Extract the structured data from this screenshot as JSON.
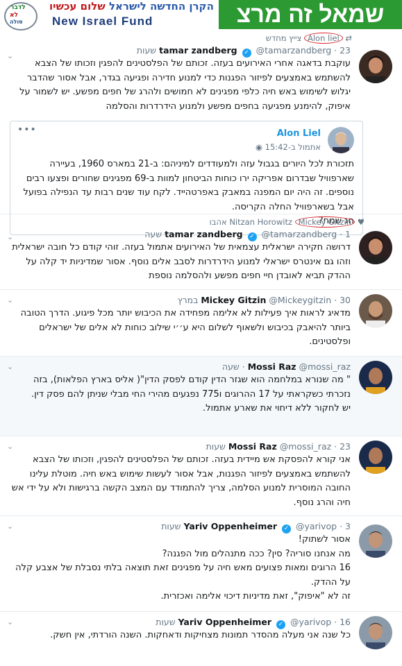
{
  "banner": {
    "logo_line1": "לדבר",
    "logo_line2": "לא",
    "logo_line3": "סולה",
    "nif_hebrew_main": "הקרן החדשה לישראל",
    "nif_hebrew_accent": "שלום עכשיו",
    "nif_english": "New Israel Fund",
    "campaign_text": "שמאל זה מרצ"
  },
  "tweets": [
    {
      "context_name": "Alon liel",
      "context_suffix": "צייץ מחדש",
      "name": "tamar zandberg",
      "handle": "@tamarzandberg",
      "time": "23 שעות",
      "body": "עוקבת בדאגה אחרי האירועים בעזה. זכותם של הפלסטינים להפגין וזכותו של הצבא להשתמש באמצעים לפיזור הפגנות כדי למנוע חדירה ופגיעה בגדר, אבל אסור שהדבר יגלוש לשימוש באש חיה כלפי מפגינים לא חמושים ולהרג של חפים מפשע. יש לשמור על איפוק, להימנע מפגיעה בחפים מפשע ולמנוע הידרדרות והסלמה",
      "quote": {
        "name": "Alon Liel",
        "time": "אתמול ב-15:42",
        "body": "תזכורת לכל היורים בגבול עזה ולמעודדים למיניהם: ב-21 במארס 1960, בעיירה שארפוויל שבדרום אפריקה ירו כוחות הביטחון למוות ב-69 מפגינים שחורים ופצעו רבים נוספים. זה היה יום המפנה במאבק באפרטהייד. לקח עוד שנים רבות עד הנפילה בפועל אבל בשארפוויל החלה הקריסה.",
        "tail": "חג שמח?"
      }
    },
    {
      "context_names": "Nitzan Horowitz",
      "context_circled": "Mickey Gitzin",
      "context_suffix": "אהבו",
      "name": "tamar zandberg",
      "handle": "@tamarzandberg",
      "time": "1 שעה",
      "body": "דרושה חקירה ישראלית עצמאית של האירועים אתמול בעזה. זוהי קודם כל חובה ישראלית וזהו גם אינטרס ישראלי למנוע הידרדרות לסבב אלים נוסף. אסור שמדיניות יד קלה על ההדק תביא לאובדן חיי חפים מפשע ולהסלמה נוספת"
    },
    {
      "name": "Mickey Gitzin",
      "handle": "@Mickeygitzin",
      "time": "30 במרץ",
      "body": "מדאיג לראות איך פעילות לא אלימה מפחידה את הכיבוש יותר מכל פיגוע. הדרך הטובה ביותר להיאבק בכיבוש ולשאוף לשלום היא ע׳׳י שילוב כוחות לא אלים של ישראלים ופלסטינים."
    },
    {
      "name": "Mossi Raz",
      "handle": "@mossi_raz",
      "time": "שעה",
      "body": "\" מה  שנורא במלחמה הוא שגזר הדין קודם לפסק הדין\"( אליס בארץ הפלאות), בזה נזכרתי כשקראתי על 17 ההרוגים ו775 נפגעים  מהירי החי מבלי שניתן להם פסק דין.",
      "tail": "יש לחקור ללא דיחוי את שארע אתמול."
    },
    {
      "name": "Mossi Raz",
      "handle": "@mossi_raz",
      "time": "23 שעות",
      "body": "אני קורא להפסקת אש מיידית בעזה. זכותם של הפלסטינים להפגין, וזכותו של הצבא להשתמש באמצעים לפיזור הפגנות, אבל אסור לעשות שימוש באש חיה. מוטלת עלינו החובה המוסרית למנוע הסלמה, צריך להתמודד עם המצב הקשה ברגישות ולא על ידי אש חיה והרג נוסף."
    },
    {
      "name": "Yariv Oppenheimer",
      "handle": "@yarivop",
      "time": "3 שעות",
      "lines": [
        "אסור לשתוק!",
        "מה אנחנו סוריה? סין? ככה מתנהלים מול הפגנה?",
        "16 הרוגים ומאות פצועים מאש חיה על מפגינים זאת תוצאה בלתי נסבלת של אצבע קלה על ההדק.",
        "זה לא \"איפוק\", זאת מדיניות דיכוי אלימה ואכזרית."
      ]
    },
    {
      "name": "Yariv Oppenheimer",
      "handle": "@yarivop",
      "time": "16 שעות",
      "body": "כל שנה אני מעלה מהסדר תמונות מצחיקות ודאחקות. השנה הורדתי, אין חשק."
    }
  ]
}
